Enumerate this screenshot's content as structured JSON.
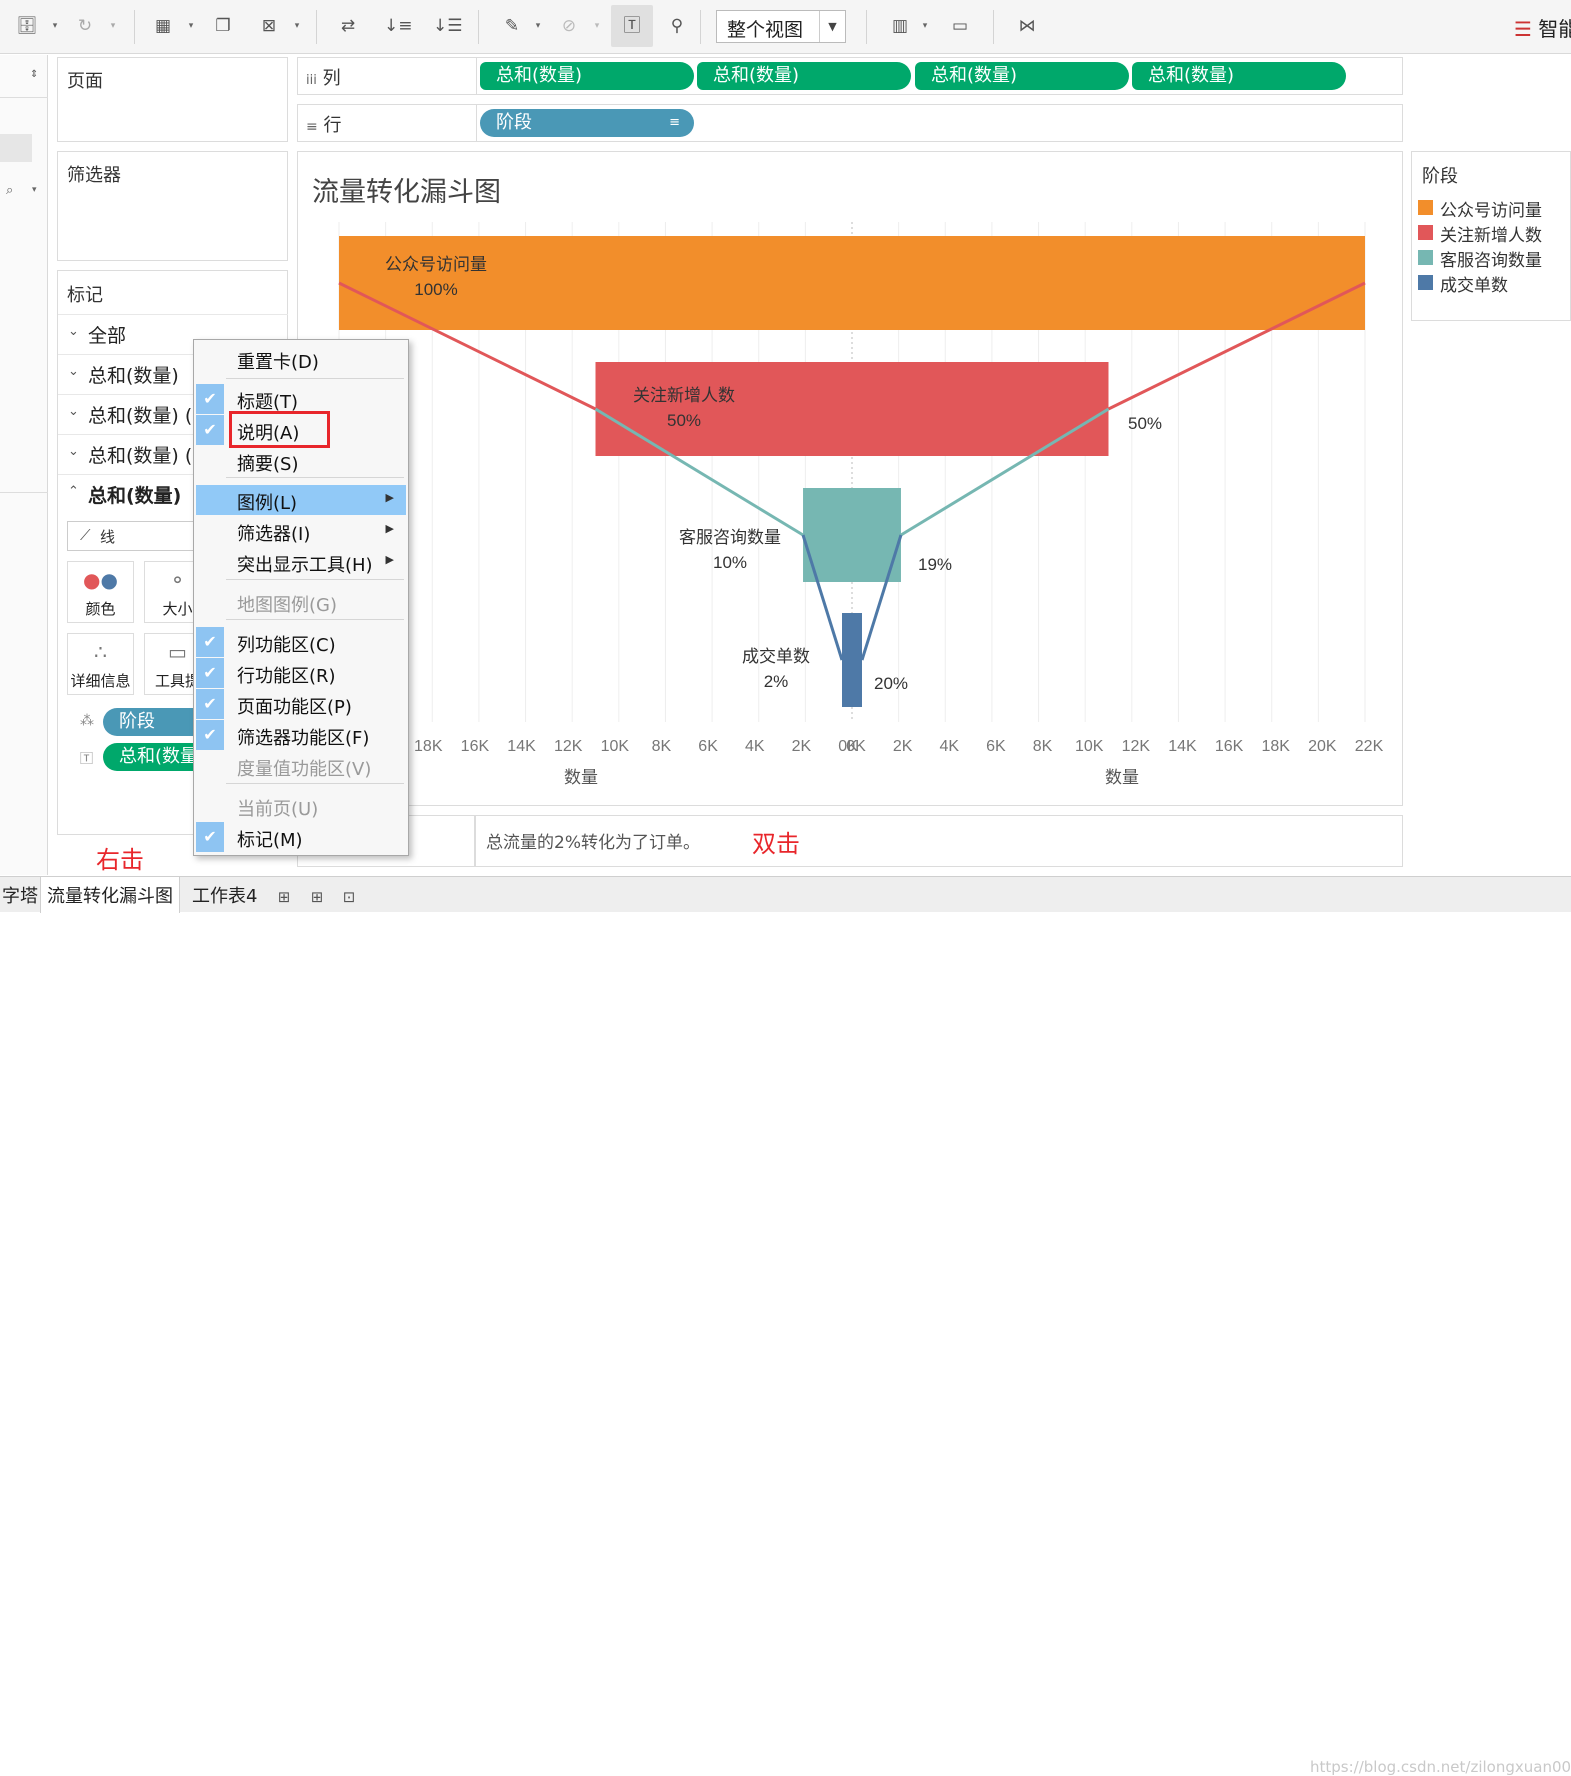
{
  "toolbar": {
    "icons": [
      "datasource-icon",
      "refresh-icon",
      "new-worksheet-icon",
      "duplicate-icon",
      "clear-sheet-icon",
      "swap-icon",
      "sort-asc-icon",
      "sort-desc-icon",
      "highlight-icon",
      "group-icon",
      "label-icon",
      "pin-icon",
      "show-me-icon",
      "presentation-icon",
      "share-icon"
    ],
    "view_select": "整个视图",
    "smart_label": "智能"
  },
  "pages_card": {
    "title": "页面"
  },
  "filters_card": {
    "title": "筛选器"
  },
  "marks_card": {
    "title": "标记",
    "rows": [
      "全部",
      "总和(数量)",
      "总和(数量) (",
      "总和(数量) (",
      "总和(数量)"
    ],
    "mark_type": "线",
    "buttons": [
      "颜色",
      "大小",
      "详细信息",
      "工具提"
    ],
    "pills": [
      "阶段",
      "总和(数量"
    ]
  },
  "shelves": {
    "columns_label": "列",
    "columns_pills": [
      "总和(数量)",
      "总和(数量)",
      "总和(数量)",
      "总和(数量)"
    ],
    "rows_label": "行",
    "rows_pill": "阶段"
  },
  "chart": {
    "title": "流量转化漏斗图"
  },
  "chart_data": {
    "type": "bar",
    "title": "流量转化漏斗图",
    "categories": [
      "公众号访问量",
      "关注新增人数",
      "客服咨询数量",
      "成交单数"
    ],
    "values": [
      22000,
      11000,
      2100,
      420
    ],
    "pct_of_total": [
      "100%",
      "50%",
      "10%",
      "2%"
    ],
    "pct_of_previous": [
      "",
      "50%",
      "19%",
      "20%"
    ],
    "colors": [
      "#f28e2b",
      "#e15759",
      "#76b7b2",
      "#4e79a7"
    ],
    "left_axis": {
      "label": "数量",
      "ticks": [
        "18K",
        "16K",
        "14K",
        "12K",
        "10K",
        "8K",
        "6K",
        "4K",
        "2K",
        "0K"
      ]
    },
    "right_axis": {
      "label": "数量",
      "ticks": [
        "0K",
        "2K",
        "4K",
        "6K",
        "8K",
        "10K",
        "12K",
        "14K",
        "16K",
        "18K",
        "20K",
        "22K"
      ]
    },
    "xlim": [
      0,
      22000
    ],
    "grid": true
  },
  "legend": {
    "title": "阶段",
    "items": [
      {
        "label": "公众号访问量",
        "color": "#f28e2b"
      },
      {
        "label": "关注新增人数",
        "color": "#e15759"
      },
      {
        "label": "客服咨询数量",
        "color": "#76b7b2"
      },
      {
        "label": "成交单数",
        "color": "#4e79a7"
      }
    ]
  },
  "caption": {
    "text": "总流量的2%转化为了订单。"
  },
  "annotations": {
    "double_click": "双击",
    "right_click": "右击"
  },
  "context_menu": {
    "items": [
      {
        "label": "重置卡(D)",
        "checked": false,
        "disabled": false
      },
      {
        "label": "标题(T)",
        "checked": true,
        "disabled": false
      },
      {
        "label": "说明(A)",
        "checked": true,
        "disabled": false
      },
      {
        "label": "摘要(S)",
        "checked": false,
        "disabled": false
      },
      {
        "label": "图例(L)",
        "checked": false,
        "disabled": false,
        "submenu": true
      },
      {
        "label": "筛选器(I)",
        "checked": false,
        "disabled": false,
        "submenu": true
      },
      {
        "label": "突出显示工具(H)",
        "checked": false,
        "disabled": false,
        "submenu": true
      },
      {
        "label": "地图图例(G)",
        "checked": false,
        "disabled": true
      },
      {
        "label": "列功能区(C)",
        "checked": true,
        "disabled": false
      },
      {
        "label": "行功能区(R)",
        "checked": true,
        "disabled": false
      },
      {
        "label": "页面功能区(P)",
        "checked": true,
        "disabled": false
      },
      {
        "label": "筛选器功能区(F)",
        "checked": true,
        "disabled": false
      },
      {
        "label": "度量值功能区(V)",
        "checked": false,
        "disabled": true
      },
      {
        "label": "当前页(U)",
        "checked": false,
        "disabled": true
      },
      {
        "label": "标记(M)",
        "checked": true,
        "disabled": false
      }
    ]
  },
  "tabs": {
    "items": [
      "字塔",
      "流量转化漏斗图",
      "工作表4"
    ],
    "active": "流量转化漏斗图"
  },
  "watermark": "https://blog.csdn.net/zilongxuan008"
}
